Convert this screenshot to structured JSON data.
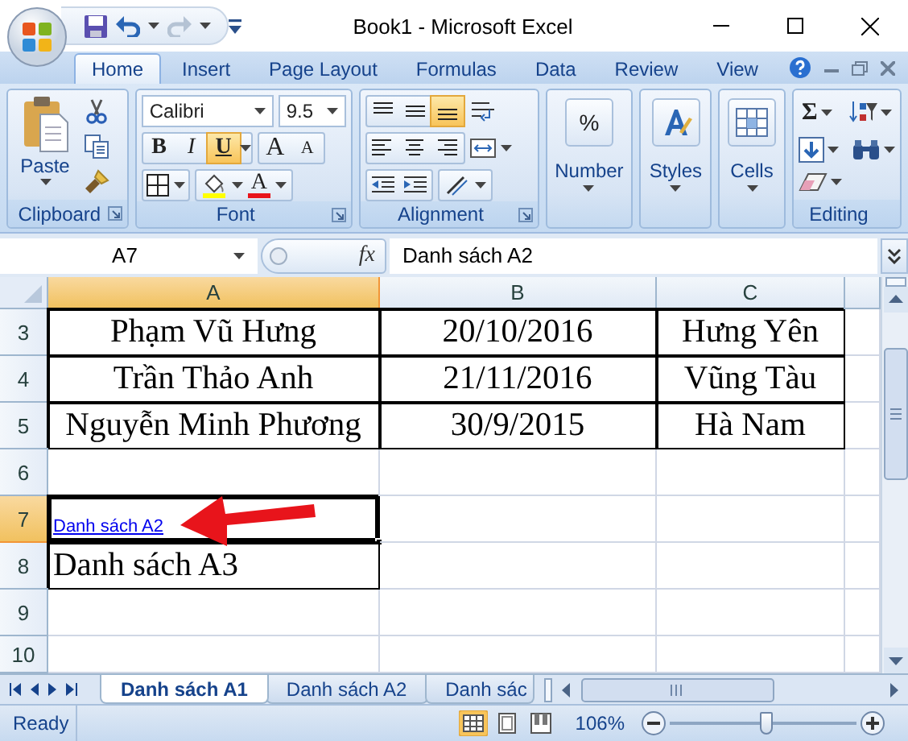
{
  "window": {
    "title": "Book1 - Microsoft Excel"
  },
  "ribbon_tabs": [
    {
      "label": "Home",
      "selected": true
    },
    {
      "label": "Insert",
      "selected": false
    },
    {
      "label": "Page Layout",
      "selected": false
    },
    {
      "label": "Formulas",
      "selected": false
    },
    {
      "label": "Data",
      "selected": false
    },
    {
      "label": "Review",
      "selected": false
    },
    {
      "label": "View",
      "selected": false
    }
  ],
  "clipboard": {
    "label": "Clipboard",
    "paste": "Paste"
  },
  "font": {
    "label": "Font",
    "name": "Calibri",
    "size": "9.5",
    "style_buttons": [
      {
        "kind": "bold",
        "text": "B",
        "active": false
      },
      {
        "kind": "italic",
        "text": "I",
        "active": false
      },
      {
        "kind": "underline",
        "text": "U",
        "active": true
      }
    ],
    "grow": "A",
    "shrink": "A",
    "color_letter": "A"
  },
  "alignment": {
    "label": "Alignment",
    "vertical": [
      {
        "kind": "top",
        "active": false
      },
      {
        "kind": "middle",
        "active": false
      },
      {
        "kind": "bottom",
        "active": true
      }
    ]
  },
  "big_groups": [
    {
      "kind": "number",
      "label": "Number",
      "icon_text": "%"
    },
    {
      "kind": "styles",
      "label": "Styles"
    },
    {
      "kind": "cells",
      "label": "Cells"
    }
  ],
  "editing": {
    "label": "Editing",
    "sum": "Σ"
  },
  "formula_bar": {
    "name_box": "A7",
    "function_button": "fx",
    "formula": "Danh sách A2"
  },
  "sheet": {
    "columns": [
      {
        "label": "A",
        "selected": true
      },
      {
        "label": "B",
        "selected": false
      },
      {
        "label": "C",
        "selected": false
      }
    ],
    "rows": [
      {
        "number": "3",
        "selected": false,
        "cells": [
          {
            "kind": "value",
            "text": "Phạm Vũ Hưng",
            "bordered": true
          },
          {
            "kind": "value",
            "text": "20/10/2016",
            "bordered": true
          },
          {
            "kind": "value",
            "text": "Hưng Yên",
            "bordered": true
          }
        ]
      },
      {
        "number": "4",
        "selected": false,
        "cells": [
          {
            "kind": "value",
            "text": "Trần Thảo Anh",
            "bordered": true
          },
          {
            "kind": "value",
            "text": "21/11/2016",
            "bordered": true
          },
          {
            "kind": "value",
            "text": "Vũng Tàu",
            "bordered": true
          }
        ]
      },
      {
        "number": "5",
        "selected": false,
        "cells": [
          {
            "kind": "value",
            "text": "Nguyễn Minh Phương",
            "bordered": true
          },
          {
            "kind": "value",
            "text": "30/9/2015",
            "bordered": true
          },
          {
            "kind": "value",
            "text": "Hà Nam",
            "bordered": true
          }
        ]
      },
      {
        "number": "6",
        "selected": false,
        "cells": [
          {
            "kind": "empty",
            "bordered": false
          },
          {
            "kind": "empty",
            "bordered": false
          },
          {
            "kind": "empty",
            "bordered": false
          }
        ]
      },
      {
        "number": "7",
        "selected": true,
        "cells": [
          {
            "kind": "link",
            "text": "Danh sách A2",
            "bordered": true
          },
          {
            "kind": "empty",
            "bordered": false
          },
          {
            "kind": "empty",
            "bordered": false
          }
        ]
      },
      {
        "number": "8",
        "selected": false,
        "cells": [
          {
            "kind": "note",
            "text": "Danh sách A3",
            "bordered": true
          },
          {
            "kind": "empty",
            "bordered": false
          },
          {
            "kind": "empty",
            "bordered": false
          }
        ]
      },
      {
        "number": "9",
        "selected": false,
        "cells": [
          {
            "kind": "empty",
            "bordered": false
          },
          {
            "kind": "empty",
            "bordered": false
          },
          {
            "kind": "empty",
            "bordered": false
          }
        ]
      },
      {
        "number": "10",
        "selected": false,
        "cells": [
          {
            "kind": "empty",
            "bordered": false
          },
          {
            "kind": "empty",
            "bordered": false
          },
          {
            "kind": "empty",
            "bordered": false
          }
        ]
      }
    ]
  },
  "sheet_tabs": [
    {
      "label": "Danh sách A1",
      "selected": true
    },
    {
      "label": "Danh sách A2",
      "selected": false
    },
    {
      "label": "Danh sác",
      "selected": false
    }
  ],
  "status_bar": {
    "status": "Ready",
    "views": [
      {
        "kind": "normal",
        "selected": true
      },
      {
        "kind": "page_layout",
        "selected": false
      },
      {
        "kind": "page_break",
        "selected": false
      }
    ],
    "zoom": "106%",
    "zoom_slider": {
      "level": 0.52
    }
  }
}
